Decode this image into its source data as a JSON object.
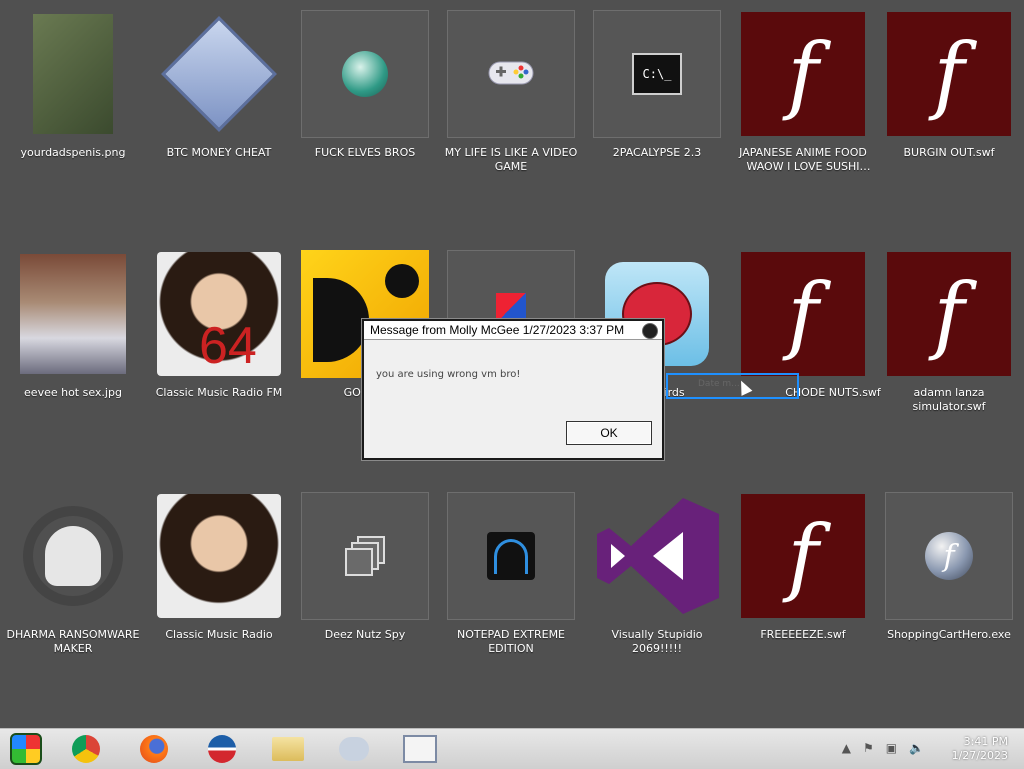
{
  "desktop": {
    "icons": [
      {
        "label": "yourdadspenis.png",
        "icon": "photo-icon"
      },
      {
        "label": "BTC MONEY CHEAT",
        "icon": "gear-diamond-icon"
      },
      {
        "label": "FUCK ELVES BROS",
        "icon": "elf-globe-icon"
      },
      {
        "label": "MY LIFE IS LIKE A VIDEO GAME",
        "icon": "gamepad-icon"
      },
      {
        "label": "2PACALYPSE 2.3",
        "icon": "cmd-icon"
      },
      {
        "label": "JAPANESE ANIME FOOD WAOW I LOVE SUSHI ANI...",
        "icon": "flash-icon"
      },
      {
        "label": "BURGIN OUT.swf",
        "icon": "flash-icon"
      },
      {
        "label": "eevee hot sex.jpg",
        "icon": "photo-icon"
      },
      {
        "label": "Classic Music Radio FM",
        "icon": "portrait-icon",
        "badge": "64"
      },
      {
        "label": "GO FUC",
        "icon": "d-logo-icon"
      },
      {
        "label": "",
        "icon": "app-icon"
      },
      {
        "label": "Birds",
        "icon": "angry-bird-icon"
      },
      {
        "label": "CHODE NUTS.swf",
        "icon": "flash-icon"
      },
      {
        "label": "adamn lanza simulator.swf",
        "icon": "flash-icon"
      },
      {
        "label": "DHARMA RANSOMWARE MAKER",
        "icon": "skull-headphones-icon"
      },
      {
        "label": "Classic Music Radio",
        "icon": "portrait-icon"
      },
      {
        "label": "Deez Nutz Spy",
        "icon": "windows-stack-icon"
      },
      {
        "label": "NOTEPAD EXTREME EDITION",
        "icon": "notepad-extreme-icon"
      },
      {
        "label": "Visually Stupidio 2069!!!!!",
        "icon": "visual-studio-icon"
      },
      {
        "label": "FREEEEEZE.swf",
        "icon": "flash-icon"
      },
      {
        "label": "ShoppingCartHero.exe",
        "icon": "flash-ball-icon"
      }
    ],
    "selection_text": "Date m..."
  },
  "dialog": {
    "title": "Message from Molly McGee 1/27/2023 3:37 PM",
    "message": "you are using wrong vm bro!",
    "ok_label": "OK"
  },
  "taskbar": {
    "clock_time": "3:41 PM",
    "clock_date": "1/27/2023",
    "apps": [
      "start-icon",
      "chrome-icon",
      "firefox-icon",
      "obama-icon",
      "folder-icon",
      "chat-icon",
      "notepad-icon"
    ]
  },
  "colors": {
    "desktop_bg": "#505050",
    "flash_tile": "#5a0a0c",
    "selection": "#1e90ff",
    "vs_purple": "#68217a"
  }
}
